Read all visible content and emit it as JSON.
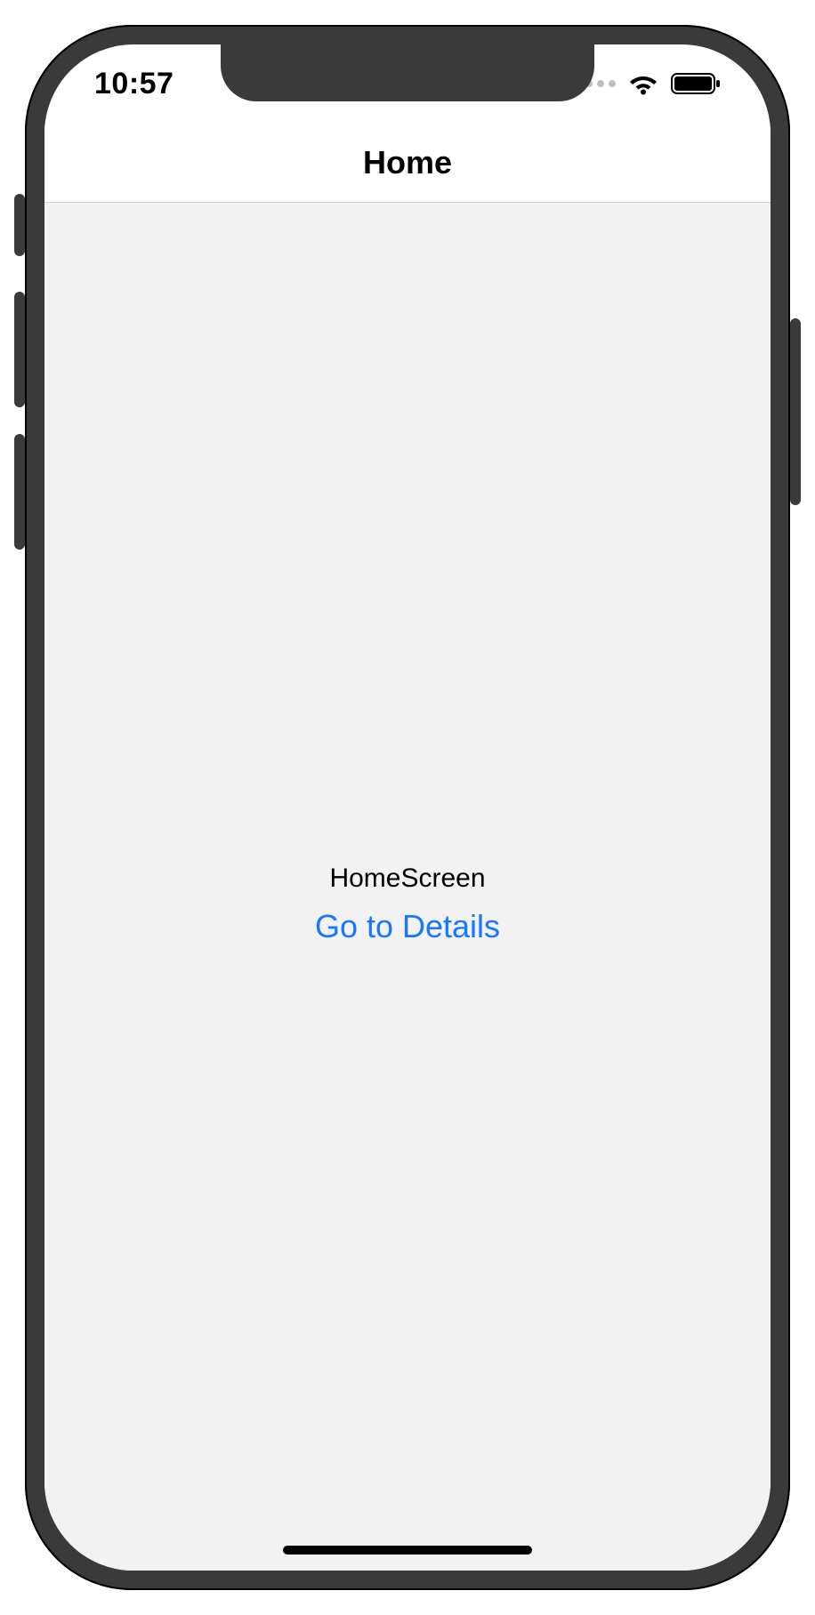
{
  "status": {
    "time": "10:57"
  },
  "nav": {
    "title": "Home"
  },
  "content": {
    "label": "HomeScreen",
    "details_button": "Go to Details"
  }
}
